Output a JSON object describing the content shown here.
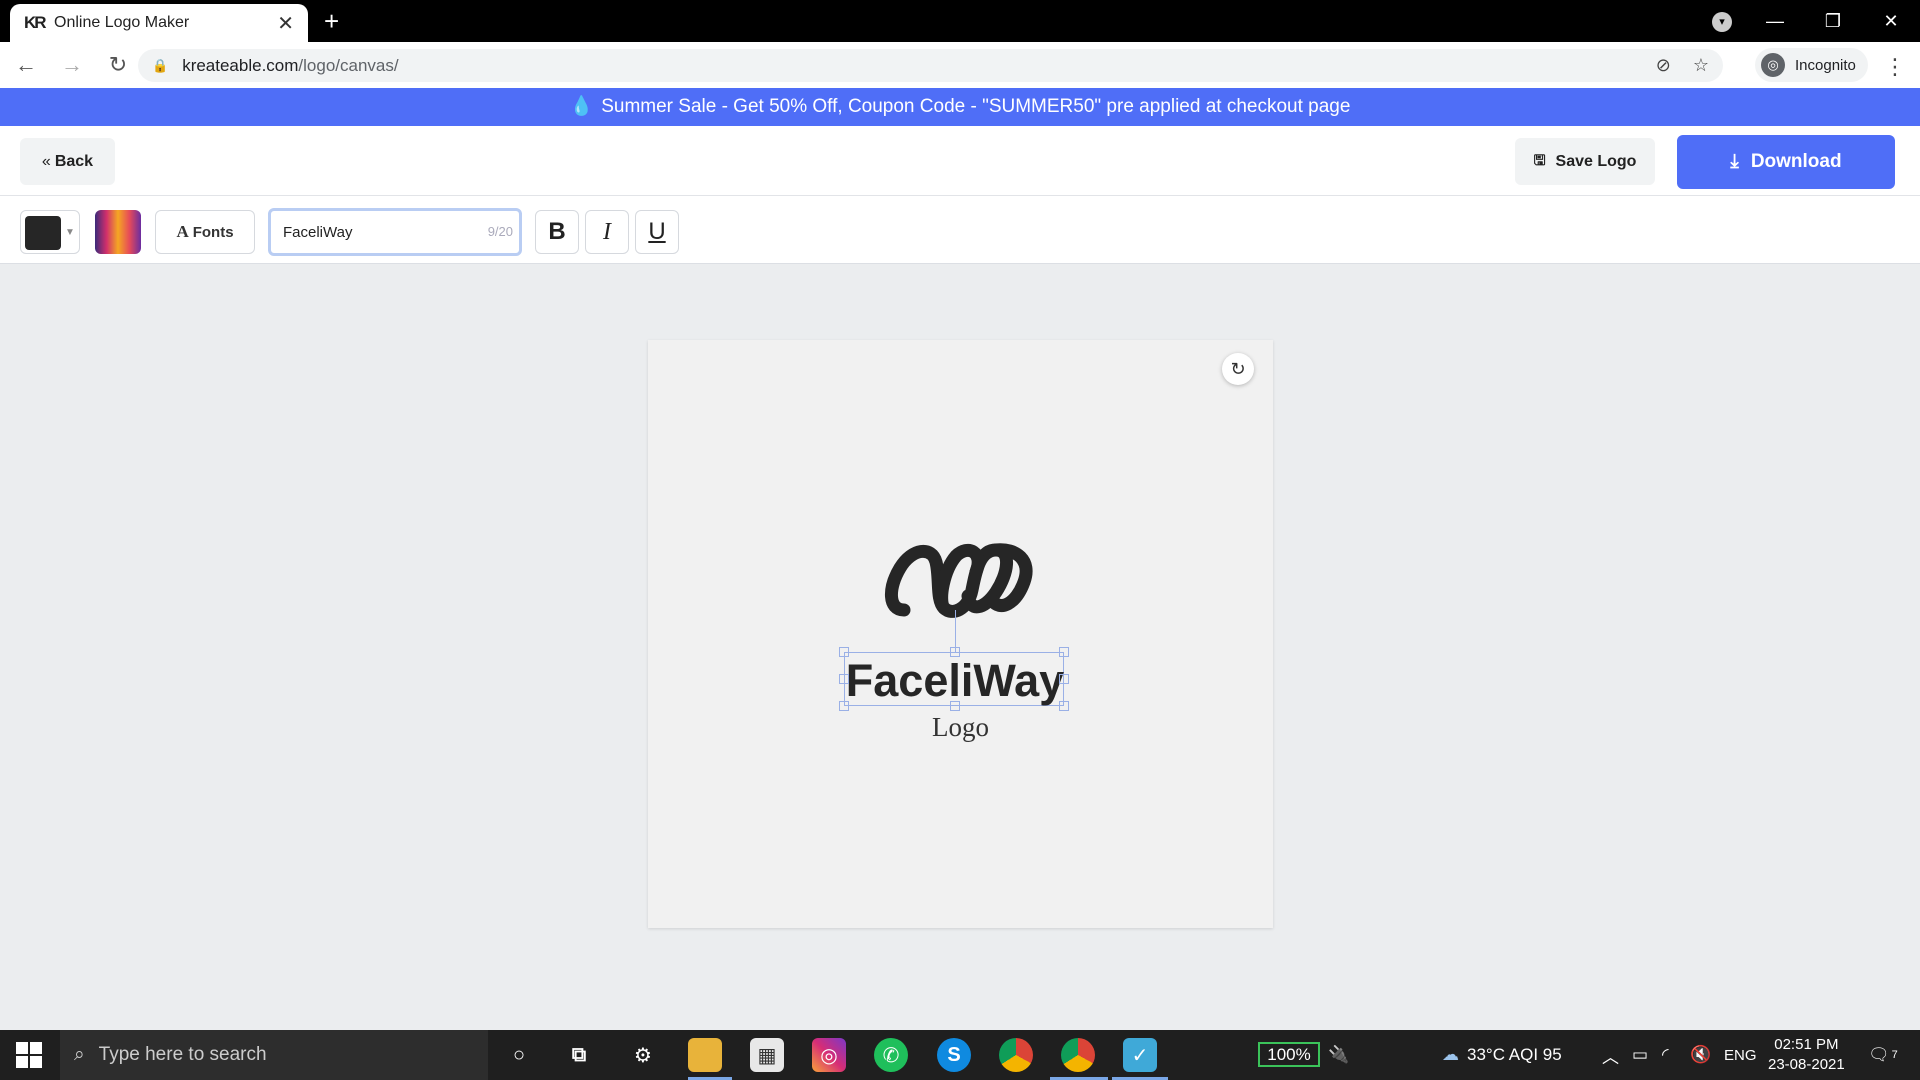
{
  "browser": {
    "tab_title": "Online Logo Maker",
    "tab_favicon": "KR",
    "url_host": "kreateable.com",
    "url_path": "/logo/canvas/",
    "profile_label": "Incognito"
  },
  "banner": {
    "text": "Summer Sale - Get 50% Off, Coupon Code - \"SUMMER50\" pre applied at checkout page"
  },
  "header": {
    "back_label": "Back",
    "save_label": "Save Logo",
    "download_label": "Download"
  },
  "toolbar": {
    "text_value": "FaceliWay",
    "char_count": "9/20",
    "fonts_label": "Fonts",
    "bold_label": "B",
    "italic_label": "I",
    "underline_label": "U",
    "selected_color": "#262626"
  },
  "canvas": {
    "brand_name": "FaceliWay",
    "slogan": "Logo",
    "background": "#f1f1f1"
  },
  "taskbar": {
    "search_placeholder": "Type here to search",
    "battery": "100%",
    "weather": "33°C  AQI 95",
    "language": "ENG",
    "time": "02:51 PM",
    "date": "23-08-2021",
    "notifications": "7"
  },
  "colors": {
    "accent": "#4f6ef7",
    "banner": "#4f6ef7"
  }
}
